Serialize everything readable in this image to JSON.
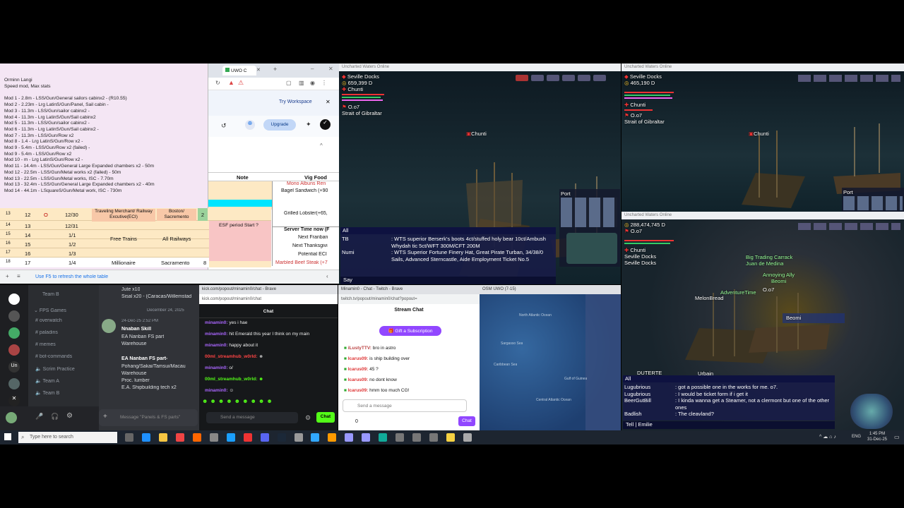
{
  "notes": {
    "header": [
      "Orminn Langi",
      "Speed mod, Max stats"
    ],
    "lines": [
      "Mod 1 - 2.8m - LSS/Gun/General sailors cabinx2 - (R10.55)",
      "Mod 2 - 2.23m - Lrg LatinS/Gun/Panel, Sail cabin -",
      "Mod 3 - 11.3m - LSS/Gun/sailor cabinx2 -",
      "Mod 4 - 11.3m - Lrg LatinS/Gun/Sail cabinx2",
      "Mod 5 - 11.3m - LSS/Gun/sailor cabinx2 -",
      "Mod 6 - 11.3m - Lrg LatinS/Gun/Sail cabinx2 -",
      "Mod 7 - 11.3m - LSS/Gun/Row x2",
      "Mod 8 - 1.4 - Lrg LatinS/Gun/Row x2 -",
      "Mod 9 - 5.4m - LSS/Gun/Row x2 (failed) -",
      "Mod 9 - 5.4m - LSS/Gun/Row x2",
      "Mod 10 - m - Lrg LatinS/Gun/Row x2 -",
      "Mod 11 - 14.4m - LSS/Gun/General Large Expanded chambers x2 - 50m",
      "Mod 12 - 22.5m - LSS/Gun/Metal works x2 (failed) - 50m",
      "Mod 13 - 22.5m - LSS/Gun/Metal works, ISC - 7.70m",
      "Mod 13 - 32.4m - LSS/Gun/General Large Expanded chambers x2 - 40m",
      "Mod 14 - 44.1m - LSquareS/Gun/Metal work, ISC - 730m"
    ]
  },
  "sheet_browser": {
    "tab_label": "UWO C",
    "try_workspace": "Try Workspace",
    "upgrade": "Upgrade",
    "col_headers": [
      "Note",
      "Vig Food"
    ],
    "vig_food": [
      "Mono Albuns Ren",
      "Bagel Sandwich (+90",
      "",
      "Grilled Lobster(+65,",
      "Server Time now (F",
      "Next Franban",
      "Next Thanksgivi",
      "Potential ECI",
      "Marbled Beef Steak (+7"
    ],
    "rows": [
      {
        "n": "13",
        "a": "12",
        "b": "O",
        "c": "12/30",
        "d": "Traveling Merchant/ Railway Excutive(ECI)",
        "e": "Boston/ Sacremento",
        "f": "2",
        "g": ""
      },
      {
        "n": "14",
        "a": "13",
        "b": "",
        "c": "12/31",
        "d": "",
        "e": "",
        "f": "",
        "g": "ESF period Start ?"
      },
      {
        "n": "15",
        "a": "14",
        "b": "",
        "c": "1/1",
        "d": "Free Trains",
        "e": "All Railways",
        "f": "",
        "g": ""
      },
      {
        "n": "16",
        "a": "15",
        "b": "",
        "c": "1/2",
        "d": "",
        "e": "",
        "f": "",
        "g": ""
      },
      {
        "n": "17",
        "a": "16",
        "b": "",
        "c": "1/3",
        "d": "",
        "e": "",
        "f": "",
        "g": ""
      },
      {
        "n": "18",
        "a": "17",
        "b": "",
        "c": "1/4",
        "d": "Millionaire",
        "e": "Sacramento",
        "f": "8",
        "g": ""
      }
    ],
    "status": "Use F5 to refresh the whole table"
  },
  "game_top_left": {
    "title": "Uncharted Waters Online",
    "location": "Seville Docks",
    "money": "659,399",
    "player": "Chunti",
    "party": "O.o7",
    "area": "Strait of Gibraltar",
    "ship_label": "Chunti",
    "port": "Port",
    "chat_tab": "All",
    "chat": [
      {
        "name": "TB",
        "msg": ": WTS superior Berserk's boots 4ct/stuffed holy bear 10ct/Ambush Whydah tic 5ct/WFT 300M/CFT 200M"
      },
      {
        "name": "Numi",
        "msg": ": WTS Superior Fortune Finery Hat, Great Pirate Turban, 34/38/0 Sails, Advanced Sterncastle, Aide Employment Ticket No.5"
      }
    ],
    "say": "Say"
  },
  "game_top_right": {
    "title": "Uncharted Waters Online",
    "location": "Seville Docks",
    "money": "465,190",
    "player": "Chunti",
    "party": "O.o7",
    "area": "Strait of Gibraltar",
    "ship_label": "Chunti",
    "port": "Port"
  },
  "game_bottom_right": {
    "title": "Uncharted Waters Online",
    "money": "288,474,745",
    "party": "O.o7",
    "player": "Chunti",
    "loc1": "Seville Docks",
    "loc2": "Seville Docks",
    "names": [
      "Big Trading Carrack",
      "Juan de Medina",
      "Annoying Ally",
      "Beomi",
      "AdventureTime",
      "O.o7",
      "MelonBread",
      "Beomi",
      "DUTERTE",
      "Urbain"
    ],
    "chat_tab": "All",
    "chat": [
      {
        "name": "Lugubrious",
        "msg": ": got a possible one in the works for me. o7."
      },
      {
        "name": "Lugubrious",
        "msg": ": I would be ticket form if i get it"
      },
      {
        "name": "BeerGutBill",
        "msg": ": I kinda wanna get a Steamer, not a clermont but one of the other ones"
      },
      {
        "name": "Badlish",
        "msg": ": The cleavland?"
      }
    ],
    "tell": "Tell",
    "tell_name": "Emilie"
  },
  "discord": {
    "channels_top": [
      "Team B"
    ],
    "category": "FPS Games",
    "channels": [
      "overwatch",
      "paladins",
      "memes",
      "bot-commands",
      "Scrim Practice",
      "Team A",
      "Team B"
    ],
    "pre_lines": [
      "Jute x10",
      "Sisal x20 - (Caracas/Willemstad"
    ],
    "date": "December 24, 2025",
    "msg_time": "24-Dec-25 2:52 PM",
    "skill_title": "Nnaban Skill",
    "lines1": [
      "EA Nanban FS part",
      "Warehouse"
    ],
    "title2": "EA Nanban FS part-",
    "lines2": [
      "Pohang/Sakai/Tamsui/Macau",
      "Warehouse",
      "Proc. lumber",
      "E.A. Shipbuilding tech x2"
    ],
    "input_placeholder": "Message \"Panels & FS parts\""
  },
  "kick": {
    "url": "kick.com/popout/minamin0/chat - Brave",
    "url2": "kick.com/popout/minamin0/chat",
    "header": "Chat",
    "messages": [
      {
        "user": "minamin0:",
        "text": "yes i hae"
      },
      {
        "user": "minamin0:",
        "text": "hit Emerald this year I think on my main"
      },
      {
        "user": "minamin0:",
        "text": "happy about it"
      },
      {
        "user": "00ml_streamhub_w0rld:",
        "text": ""
      },
      {
        "user": "minamin0:",
        "text": "o/"
      },
      {
        "user": "00ml_streamhub_w0rld:",
        "text": ""
      },
      {
        "user": "minamin0:",
        "text": ""
      }
    ],
    "send": "Send a message",
    "chat_btn": "Chat"
  },
  "twitch": {
    "title": "Minamin0 - Chat - Twitch - Brave",
    "url": "twitch.tv/popout/minamin0/chat?popout=",
    "header": "Stream Chat",
    "gift": "Gift a Subscription",
    "messages": [
      {
        "user": "iLustyTTV:",
        "text": "bro in astro"
      },
      {
        "user": "Icarus09:",
        "text": "is ship building over"
      },
      {
        "user": "Icarus09:",
        "text": "45 ?"
      },
      {
        "user": "Icarus09:",
        "text": "no dont know"
      },
      {
        "user": "Icarus09:",
        "text": "hmm too much CG!"
      }
    ],
    "send": "Send a message",
    "points": "0",
    "chat_btn": "Chat"
  },
  "mapwin": {
    "title": "OSM UWO (7-15)",
    "labels": [
      "North Atlantic Ocean",
      "Sargasso Sea",
      "Caribbean Sea",
      "Gulf of Guinea",
      "Central Atlantic Ocean"
    ]
  },
  "taskbar": {
    "search": "Type here to search",
    "lang": "ENG",
    "time": "1:45 PM",
    "date": "31-Dec-25"
  },
  "colors": {
    "accent_blue": "#1a73e8",
    "twitch_purple": "#9147ff",
    "kick_green": "#53fc18",
    "discord_bg": "#313338",
    "cyan_cell": "#00e5ff",
    "pink_cell": "#f8c5c5",
    "peach_cell": "#fde9c4"
  }
}
